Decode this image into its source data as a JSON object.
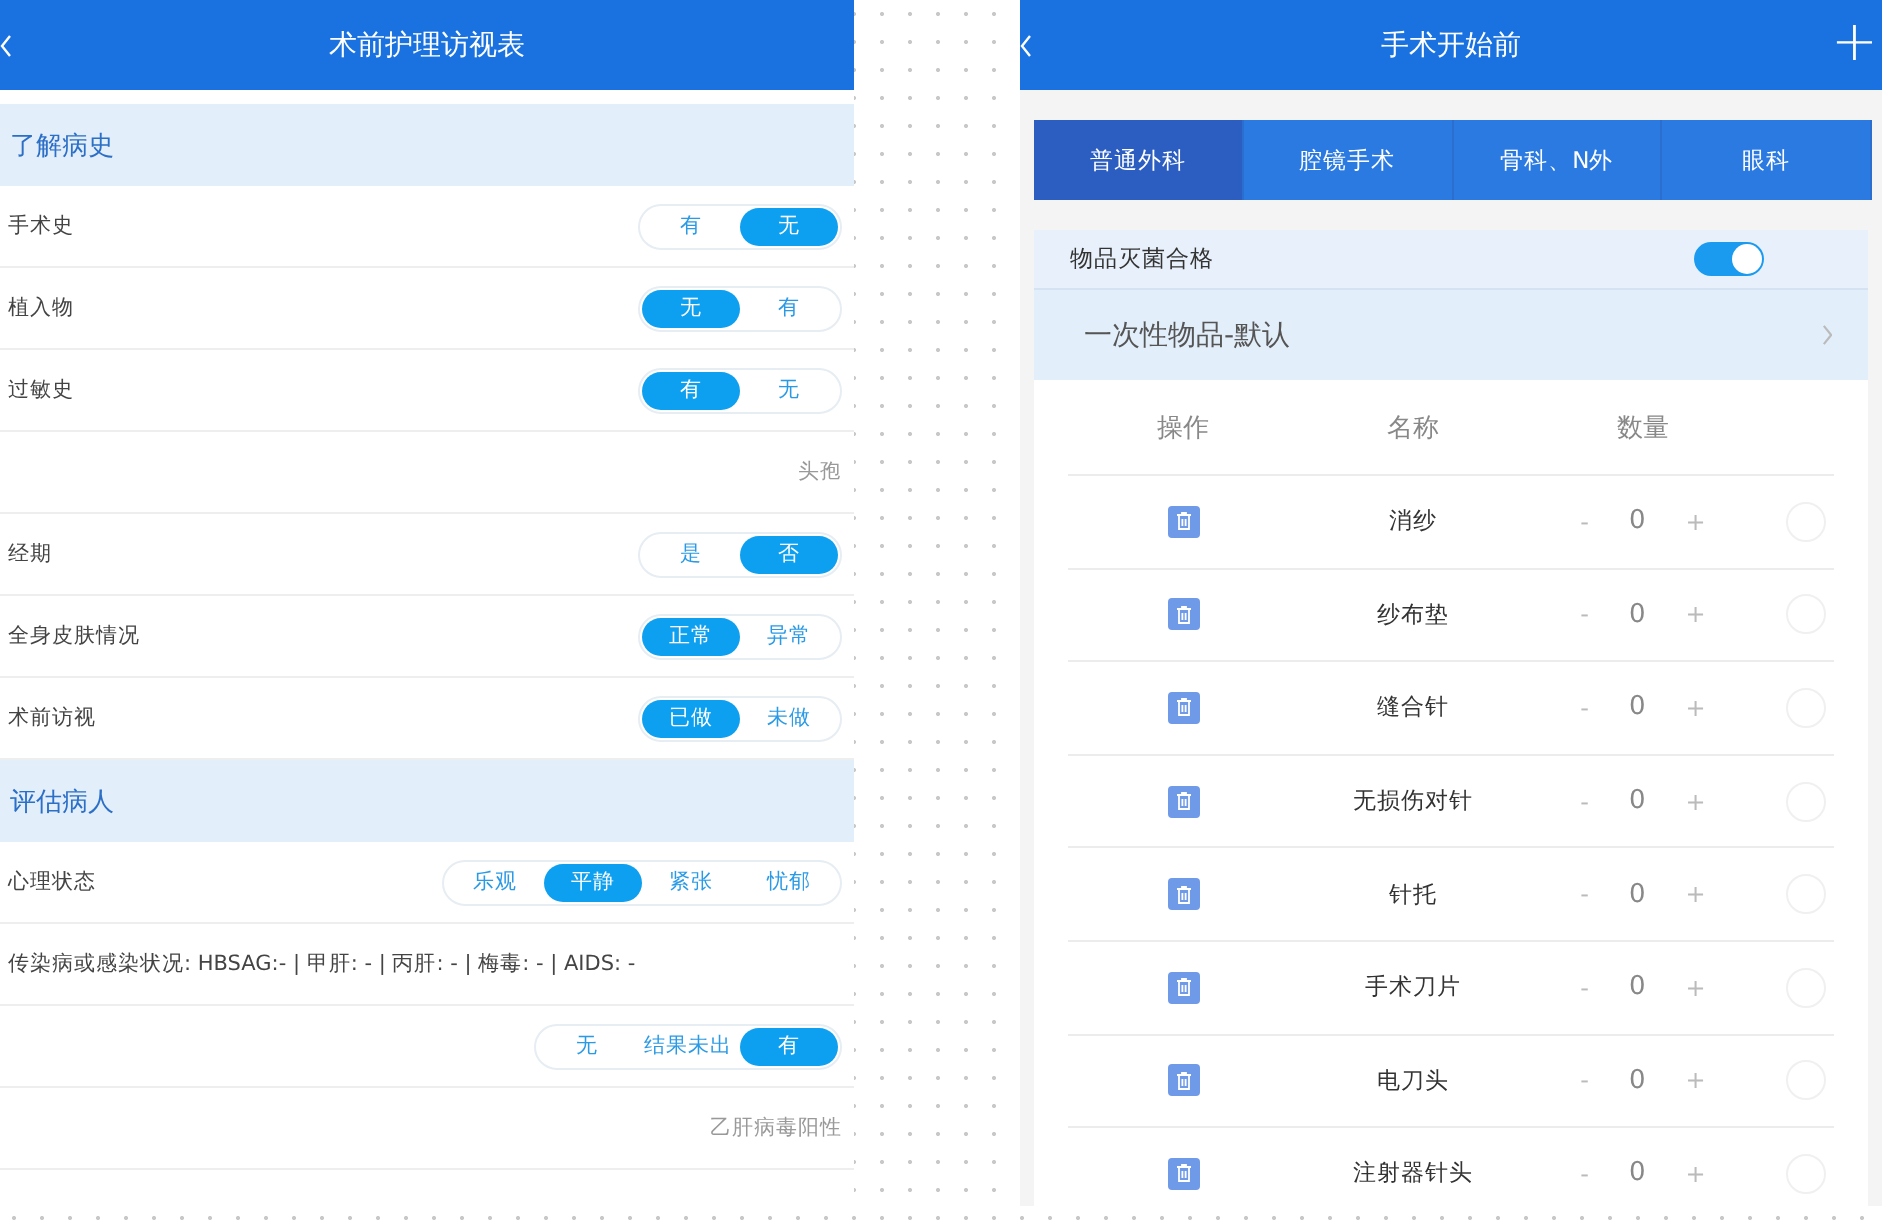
{
  "left_screen": {
    "header": {
      "title": "术前护理访视表"
    },
    "rows": [
      {
        "kind": "section",
        "label": "了解病史"
      },
      {
        "kind": "choice",
        "label": "手术史",
        "options": [
          {
            "label": "有",
            "selected": false
          },
          {
            "label": "无",
            "selected": true
          }
        ]
      },
      {
        "kind": "choice",
        "label": "植入物",
        "options": [
          {
            "label": "无",
            "selected": true
          },
          {
            "label": "有",
            "selected": false
          }
        ]
      },
      {
        "kind": "choice",
        "label": "过敏史",
        "options": [
          {
            "label": "有",
            "selected": true
          },
          {
            "label": "无",
            "selected": false
          }
        ]
      },
      {
        "kind": "note",
        "label": "头孢"
      },
      {
        "kind": "choice",
        "label": "经期",
        "options": [
          {
            "label": "是",
            "selected": false
          },
          {
            "label": "否",
            "selected": true
          }
        ]
      },
      {
        "kind": "choice",
        "label": "全身皮肤情况",
        "options": [
          {
            "label": "正常",
            "selected": true
          },
          {
            "label": "异常",
            "selected": false
          }
        ]
      },
      {
        "kind": "choice",
        "label": "术前访视",
        "options": [
          {
            "label": "已做",
            "selected": true
          },
          {
            "label": "未做",
            "selected": false
          }
        ]
      },
      {
        "kind": "section",
        "label": "评估病人"
      },
      {
        "kind": "choice",
        "label": "心理状态",
        "options": [
          {
            "label": "乐观",
            "selected": false
          },
          {
            "label": "平静",
            "selected": true
          },
          {
            "label": "紧张",
            "selected": false
          },
          {
            "label": "忧郁",
            "selected": false
          }
        ]
      },
      {
        "kind": "text",
        "label": "传染病或感染状况: HBSAG:- | 甲肝: - | 丙肝: - | 梅毒: - | AIDS: -"
      },
      {
        "kind": "choice",
        "label": "",
        "options": [
          {
            "label": "无",
            "selected": false
          },
          {
            "label": "结果未出",
            "selected": false
          },
          {
            "label": "有",
            "selected": true
          }
        ]
      },
      {
        "kind": "note",
        "label": "乙肝病毒阳性"
      }
    ]
  },
  "right_screen": {
    "header": {
      "title": "手术开始前",
      "action": "+"
    },
    "tabs": [
      {
        "label": "普通外科",
        "selected": true
      },
      {
        "label": "腔镜手术",
        "selected": false
      },
      {
        "label": "骨科、N外",
        "selected": false
      },
      {
        "label": "眼科",
        "selected": false
      }
    ],
    "sterile_toggle": {
      "label": "物品灭菌合格",
      "on": true
    },
    "category": {
      "label": "一次性物品-默认"
    },
    "table": {
      "columns": [
        "操作",
        "名称",
        "数量"
      ],
      "rows": [
        {
          "name": "消纱",
          "minus": "-",
          "count": "0",
          "plus": "+",
          "checked": false
        },
        {
          "name": "纱布垫",
          "minus": "-",
          "count": "0",
          "plus": "+",
          "checked": false
        },
        {
          "name": "缝合针",
          "minus": "-",
          "count": "0",
          "plus": "+",
          "checked": false
        },
        {
          "name": "无损伤对针",
          "minus": "-",
          "count": "0",
          "plus": "+",
          "checked": false
        },
        {
          "name": "针托",
          "minus": "-",
          "count": "0",
          "plus": "+",
          "checked": false
        },
        {
          "name": "手术刀片",
          "minus": "-",
          "count": "0",
          "plus": "+",
          "checked": false
        },
        {
          "name": "电刀头",
          "minus": "-",
          "count": "0",
          "plus": "+",
          "checked": false
        },
        {
          "name": "注射器针头",
          "minus": "-",
          "count": "0",
          "plus": "+",
          "checked": false
        }
      ]
    }
  }
}
